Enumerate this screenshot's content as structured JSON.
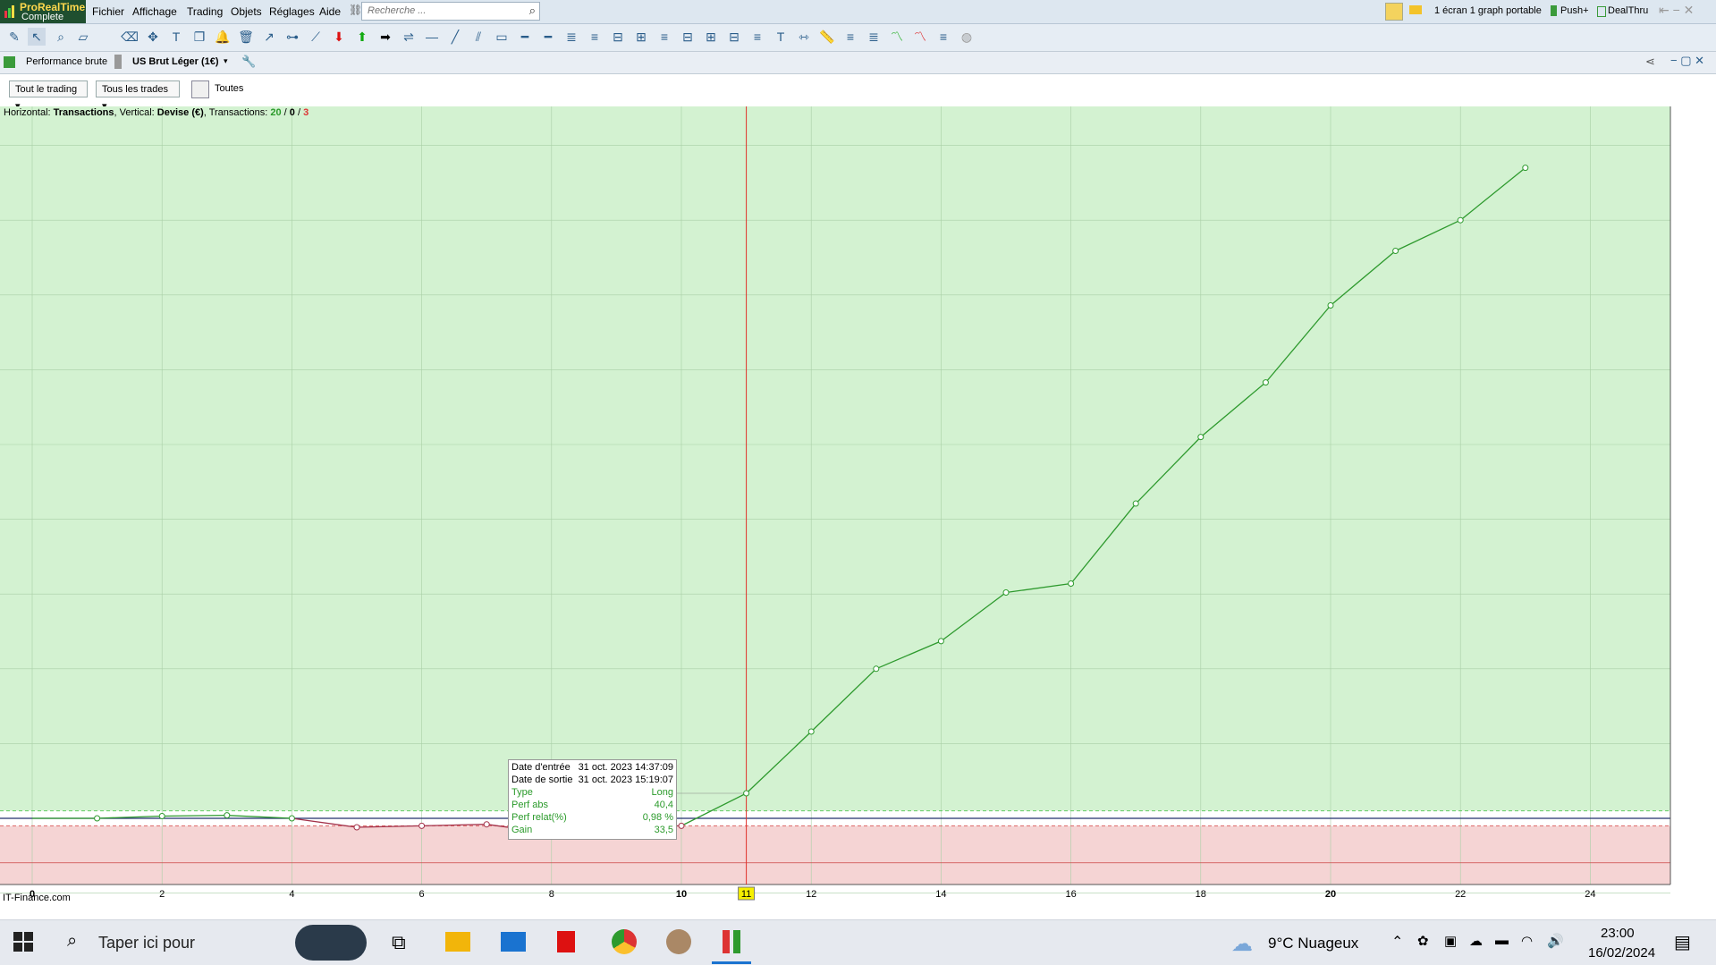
{
  "app": {
    "name_line1": "ProRealTime",
    "name_line2": "Complete"
  },
  "menu": [
    "Fichier",
    "Affichage",
    "Trading",
    "Objets",
    "Réglages",
    "Aide"
  ],
  "search": {
    "placeholder": "Recherche ..."
  },
  "topright": {
    "layout": "1 écran 1 graph portable",
    "push": "Push+",
    "dealthru": "DealThru"
  },
  "chart_header": {
    "title": "Performance brute",
    "instrument": "US Brut Léger (1€)"
  },
  "filters": {
    "trading": "Tout le trading",
    "trades": "Tous les trades",
    "period": "Toutes"
  },
  "info": {
    "prefix": "Horizontal: ",
    "h_value": "Transactions",
    "mid": ", Vertical: ",
    "v_value": "Devise (€)",
    "tx_label": ", Transactions: ",
    "tx_win": "20",
    "tx_sep1": " / ",
    "tx_zero": "0",
    "tx_sep2": " / ",
    "tx_loss": "3"
  },
  "watermark": "IT-Finance.com",
  "tooltip": {
    "rows": [
      {
        "k": "Date d'entrée",
        "v": "31 oct. 2023 14:37:09"
      },
      {
        "k": "Date de sortie",
        "v": "31 oct. 2023 15:19:07"
      },
      {
        "k": "Type",
        "v": "Long"
      },
      {
        "k": "Perf abs",
        "v": "40,4"
      },
      {
        "k": "Perf relat(%)",
        "v": "0,98 %"
      },
      {
        "k": "Gain",
        "v": "33,5"
      }
    ]
  },
  "chart_data": {
    "type": "line",
    "x": [
      0,
      1,
      2,
      3,
      4,
      5,
      6,
      7,
      8,
      9,
      10,
      11,
      12,
      13,
      14,
      15,
      16,
      17,
      18,
      19,
      20,
      21,
      22,
      23
    ],
    "values": [
      0,
      0,
      3,
      4,
      0,
      -12,
      -10,
      -8,
      -20,
      -11,
      -10,
      33.5,
      116,
      200,
      237,
      302,
      314,
      421,
      510,
      583,
      686,
      759,
      800,
      870.1
    ],
    "xlim": [
      0,
      25
    ],
    "ylim": [
      -100,
      960
    ],
    "xticks": [
      "0",
      "2",
      "4",
      "6",
      "8",
      "10",
      "11",
      "12",
      "14",
      "16",
      "18",
      "20",
      "22",
      "24"
    ],
    "yticks": [
      "-100",
      "100",
      "200",
      "300",
      "400",
      "500",
      "600",
      "700",
      "800",
      "900"
    ],
    "markers": {
      "current": "870,1",
      "upper": "10",
      "lower": "-10",
      "min": "-59,53"
    },
    "cursor_x": "11",
    "colors": {
      "gain": "#d3f2d1",
      "loss": "#f5d4d4",
      "line": "#2e9a2e",
      "cursor": "#e0302a"
    }
  },
  "taskbar": {
    "search_placeholder": "Taper ici pour",
    "weather": "9°C  Nuageux",
    "time": "23:00",
    "date": "16/02/2024"
  }
}
